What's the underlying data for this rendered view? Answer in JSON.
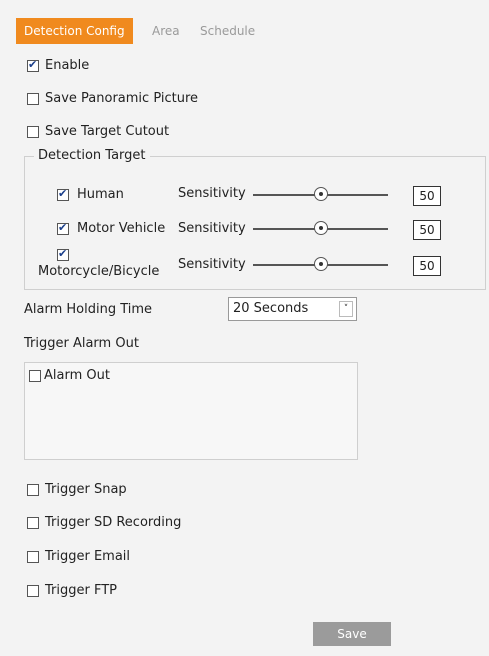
{
  "tabs": [
    {
      "label": "Detection Config",
      "active": true
    },
    {
      "label": "Area",
      "active": false
    },
    {
      "label": "Schedule",
      "active": false
    }
  ],
  "options": {
    "enable": {
      "label": "Enable",
      "checked": true
    },
    "save_panoramic": {
      "label": "Save Panoramic Picture",
      "checked": false
    },
    "save_cutout": {
      "label": "Save Target Cutout",
      "checked": false
    }
  },
  "detection_target": {
    "legend": "Detection Target",
    "sensitivity_label": "Sensitivity",
    "targets": [
      {
        "label": "Human",
        "checked": true,
        "sensitivity": "50",
        "level": 0.5
      },
      {
        "label": "Motor Vehicle",
        "checked": true,
        "sensitivity": "50",
        "level": 0.5
      },
      {
        "label": "Motorcycle/Bicycle",
        "checked": true,
        "sensitivity": "50",
        "level": 0.5
      }
    ]
  },
  "alarm_holding": {
    "label": "Alarm Holding Time",
    "value": "20 Seconds",
    "arrow": "˅"
  },
  "trigger_alarm_out": {
    "label": "Trigger Alarm Out",
    "item": "Alarm Out",
    "checked": false
  },
  "triggers": [
    {
      "label": "Trigger Snap",
      "checked": false
    },
    {
      "label": "Trigger SD Recording",
      "checked": false
    },
    {
      "label": "Trigger Email",
      "checked": false
    },
    {
      "label": "Trigger FTP",
      "checked": false
    }
  ],
  "save_label": "Save",
  "colors": {
    "accent": "#f08a1e",
    "button": "#9b9b9b",
    "background": "#f3f3f3"
  }
}
